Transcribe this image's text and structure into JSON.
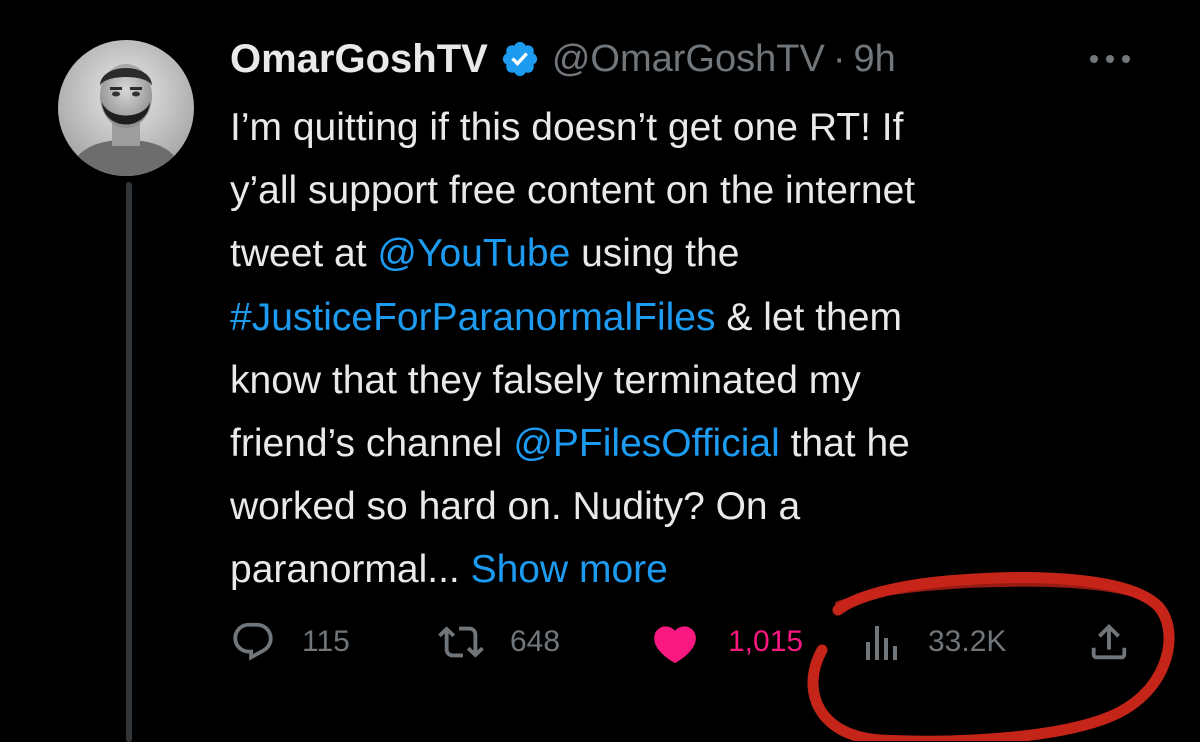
{
  "tweet": {
    "author": {
      "display_name": "OmarGoshTV",
      "handle": "@OmarGoshTV",
      "separator": "·",
      "time": "9h",
      "verified": true,
      "avatar_icon": "avatar-photo"
    },
    "text_lines": [
      [
        {
          "t": "I’m quitting if this doesn’t get one RT! If",
          "link": false
        }
      ],
      [
        {
          "t": "y’all support free content on the internet",
          "link": false
        }
      ],
      [
        {
          "t": "tweet at ",
          "link": false
        },
        {
          "t": "@YouTube",
          "link": true
        },
        {
          "t": " using the",
          "link": false
        }
      ],
      [
        {
          "t": "#JusticeForParanormalFiles",
          "link": true
        },
        {
          "t": " & let them",
          "link": false
        }
      ],
      [
        {
          "t": "know that they falsely terminated my",
          "link": false
        }
      ],
      [
        {
          "t": "friend’s channel ",
          "link": false
        },
        {
          "t": "@PFilesOfficial",
          "link": true
        },
        {
          "t": " that he",
          "link": false
        }
      ],
      [
        {
          "t": "worked so hard on. Nudity? On a",
          "link": false
        }
      ],
      [
        {
          "t": "paranormal... ",
          "link": false
        },
        {
          "t": "Show more",
          "link": true
        }
      ]
    ],
    "actions": {
      "replies": "115",
      "retweets": "648",
      "likes": "1,015",
      "views": "33.2K"
    }
  },
  "colors": {
    "background": "#000000",
    "text": "#e7e9ea",
    "secondary": "#71767b",
    "link": "#1d9bf0",
    "like": "#f91880",
    "verified": "#1d9bf0",
    "marker": "#d6281a"
  },
  "icons": [
    "verified-badge-icon",
    "more-options-icon",
    "reply-icon",
    "retweet-icon",
    "like-heart-icon",
    "views-analytics-icon",
    "share-icon"
  ]
}
